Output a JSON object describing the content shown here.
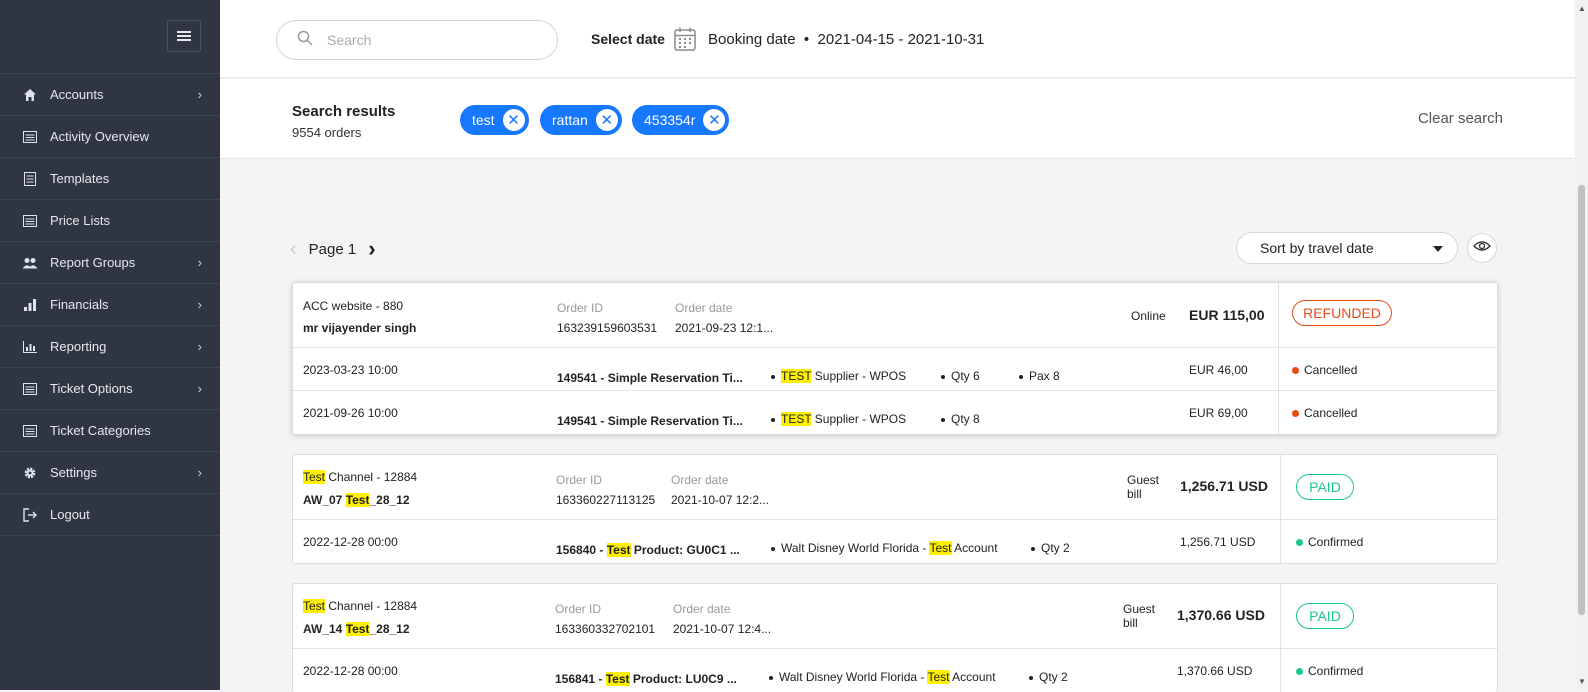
{
  "sidebar": {
    "items": [
      {
        "label": "Accounts",
        "icon": "home-icon",
        "has_sub": true
      },
      {
        "label": "Activity Overview",
        "icon": "list-icon",
        "has_sub": false
      },
      {
        "label": "Templates",
        "icon": "document-icon",
        "has_sub": false
      },
      {
        "label": "Price Lists",
        "icon": "list-icon",
        "has_sub": false
      },
      {
        "label": "Report Groups",
        "icon": "users-icon",
        "has_sub": true
      },
      {
        "label": "Financials",
        "icon": "bar-chart-icon",
        "has_sub": true
      },
      {
        "label": "Reporting",
        "icon": "chart-icon",
        "has_sub": true
      },
      {
        "label": "Ticket Options",
        "icon": "list-icon",
        "has_sub": true
      },
      {
        "label": "Ticket Categories",
        "icon": "list-icon",
        "has_sub": false
      },
      {
        "label": "Settings",
        "icon": "gear-icon",
        "has_sub": true
      },
      {
        "label": "Logout",
        "icon": "logout-icon",
        "has_sub": false
      }
    ]
  },
  "topbar": {
    "search_placeholder": "Search",
    "select_date_label": "Select date",
    "date_type": "Booking date",
    "separator": "•",
    "date_range": "2021-04-15 - 2021-10-31"
  },
  "results": {
    "title": "Search results",
    "count": "9554 orders",
    "chips": [
      "test",
      "rattan",
      "453354r"
    ],
    "clear_label": "Clear search"
  },
  "pager": {
    "label": "Page 1"
  },
  "sort": {
    "label": "Sort by travel date"
  },
  "labels": {
    "order_id": "Order ID",
    "order_date": "Order date"
  },
  "orders": {
    "o1": {
      "channel": "ACC website - 880",
      "customer": "mr vijayender singh",
      "order_id": "163239159603531",
      "order_date": "2021-09-23 12:1...",
      "payment": "Online",
      "total": "EUR 115,00",
      "status": "REFUNDED",
      "l1": {
        "date": "2023-03-23 10:00",
        "product": "149541 - Simple Reservation Ti...",
        "supplier_hl": "TEST",
        "supplier_rest": " Supplier - WPOS",
        "qty": "Qty 6",
        "pax": "Pax 8",
        "amount": "EUR 46,00",
        "state": "Cancelled"
      },
      "l2": {
        "date": "2021-09-26 10:00",
        "product": "149541 - Simple Reservation Ti...",
        "supplier_hl": "TEST",
        "supplier_rest": " Supplier - WPOS",
        "qty": "Qty 8",
        "amount": "EUR 69,00",
        "state": "Cancelled"
      }
    },
    "o2": {
      "ch_hl": "Test",
      "ch_rest": " Channel - 12884",
      "cu_a": "AW_07 ",
      "cu_hl": "Test",
      "cu_b": "_28_12",
      "order_id": "163360227113125",
      "order_date": "2021-10-07 12:2...",
      "pay_a": "Guest",
      "pay_b": "bill",
      "total": "1,256.71 USD",
      "status": "PAID",
      "l1": {
        "date": "2022-12-28 00:00",
        "p_a": "156840 - ",
        "p_hl": "Test",
        "p_b": " Product: GU0C1 ...",
        "s_a": "Walt Disney World Florida - ",
        "s_hl": "Test",
        "s_b": " Account",
        "qty": "Qty 2",
        "amount": "1,256.71 USD",
        "state": "Confirmed"
      }
    },
    "o3": {
      "ch_hl": "Test",
      "ch_rest": " Channel - 12884",
      "cu_a": "AW_14 ",
      "cu_hl": "Test",
      "cu_b": "_28_12",
      "order_id": "163360332702101",
      "order_date": "2021-10-07 12:4...",
      "pay_a": "Guest",
      "pay_b": "bill",
      "total": "1,370.66 USD",
      "status": "PAID",
      "l1": {
        "date": "2022-12-28 00:00",
        "p_a": "156841 - ",
        "p_hl": "Test",
        "p_b": " Product: LU0C9 ...",
        "s_a": "Walt Disney World Florida - ",
        "s_hl": "Test",
        "s_b": " Account",
        "qty": "Qty 2",
        "amount": "1,370.66 USD",
        "state": "Confirmed"
      }
    }
  },
  "colors": {
    "sidebar": "#2f3542",
    "accent": "#1677ff",
    "refunded": "#e64a19",
    "paid": "#1cc78a",
    "highlight": "#ffef00"
  }
}
